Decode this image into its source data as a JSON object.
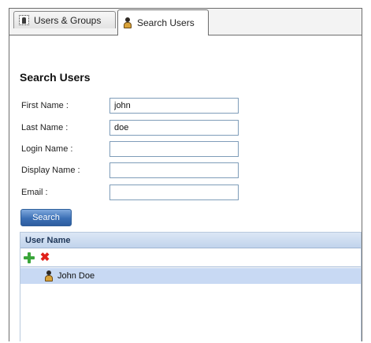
{
  "tabs": [
    {
      "label": "Users & Groups",
      "icon": "users-groups-icon",
      "active": false
    },
    {
      "label": "Search Users",
      "icon": "user-icon",
      "active": true
    }
  ],
  "form": {
    "heading": "Search Users",
    "fields": [
      {
        "label": "First Name :",
        "value": "john"
      },
      {
        "label": "Last Name :",
        "value": "doe"
      },
      {
        "label": "Login Name :",
        "value": ""
      },
      {
        "label": "Display Name :",
        "value": ""
      },
      {
        "label": "Email :",
        "value": ""
      }
    ],
    "search_button": "Search"
  },
  "results": {
    "column_header": "User Name",
    "toolbar": {
      "add_icon": "add-icon",
      "delete_icon": "delete-icon"
    },
    "rows": [
      {
        "name": "John Doe",
        "icon": "user-icon",
        "selected": true
      }
    ]
  },
  "colors": {
    "button_blue": "#3b6fb5",
    "selection": "#c8d9f3",
    "add_green": "#3aa53a",
    "delete_red": "#e0201a"
  }
}
